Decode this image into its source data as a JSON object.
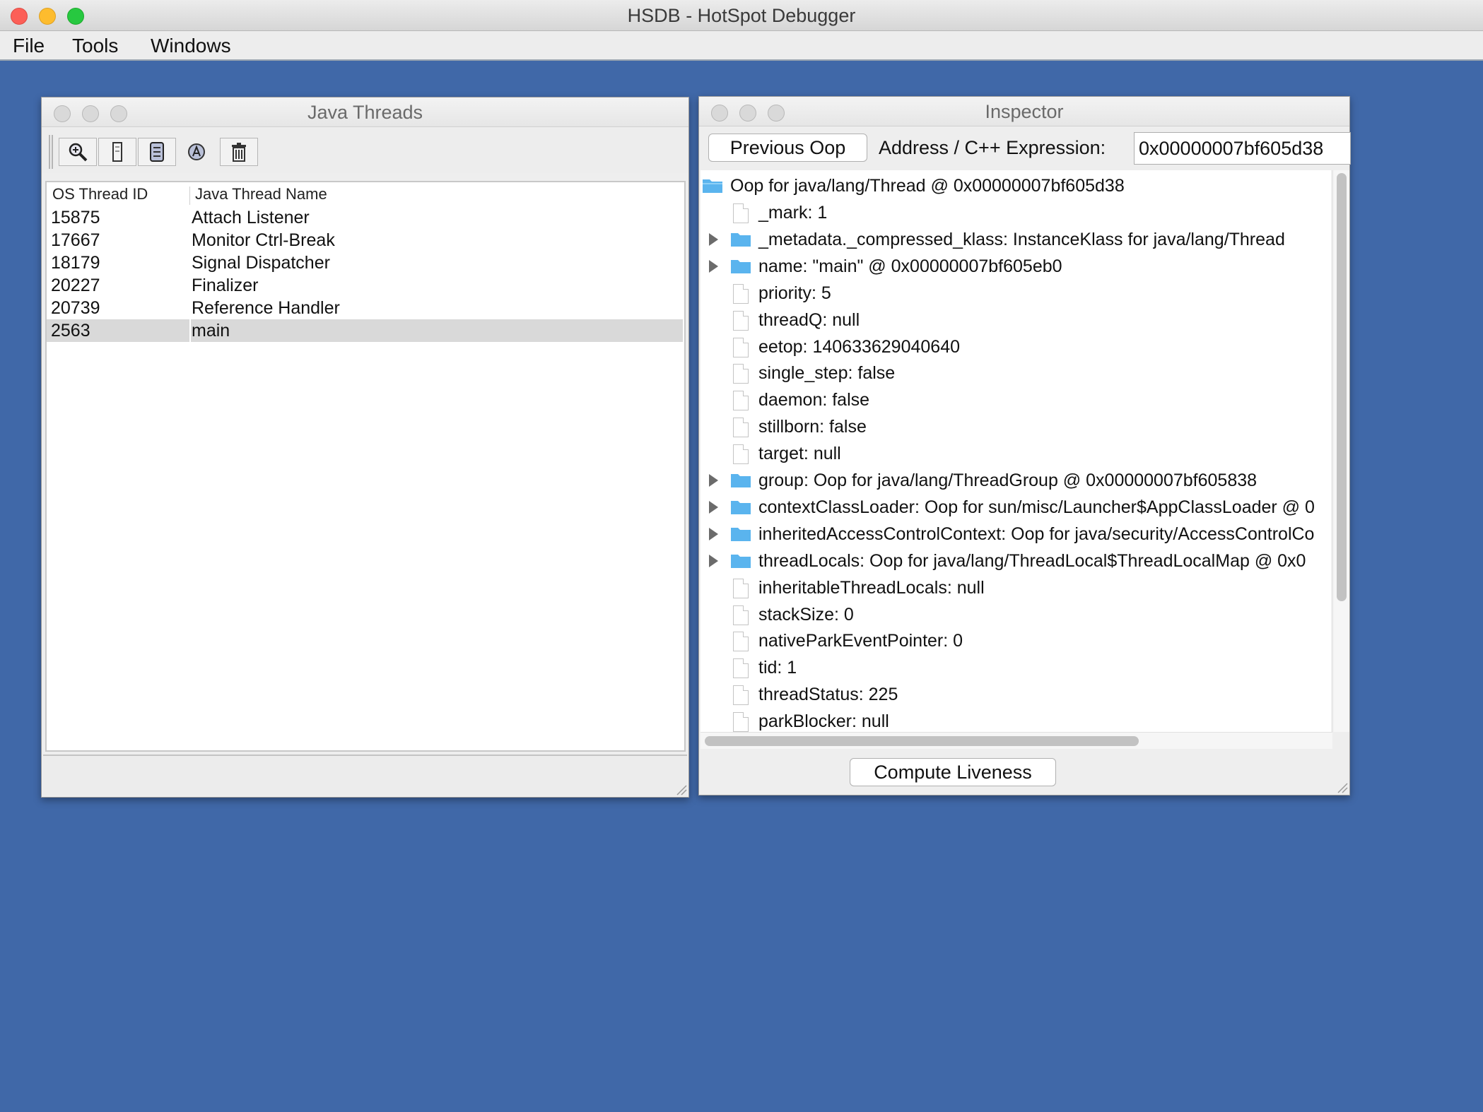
{
  "window": {
    "title": "HSDB - HotSpot Debugger"
  },
  "menu": [
    "File",
    "Tools",
    "Windows"
  ],
  "java_threads": {
    "title": "Java Threads",
    "toolbar_icons": [
      "inspect-thread-icon",
      "stack-memory-icon",
      "show-java-stack-icon",
      "thread-info-icon",
      "trash-icon"
    ],
    "columns": [
      "OS Thread ID",
      "Java Thread Name"
    ],
    "rows": [
      {
        "id": "15875",
        "name": "Attach Listener"
      },
      {
        "id": "17667",
        "name": "Monitor Ctrl-Break"
      },
      {
        "id": "18179",
        "name": "Signal Dispatcher"
      },
      {
        "id": "20227",
        "name": "Finalizer"
      },
      {
        "id": "20739",
        "name": "Reference Handler"
      },
      {
        "id": "2563",
        "name": "main"
      }
    ],
    "selected_row": 5
  },
  "inspector": {
    "title": "Inspector",
    "previous_button": "Previous Oop",
    "address_label": "Address / C++ Expression:",
    "address_value": "0x00000007bf605d38",
    "root": "Oop for java/lang/Thread @ 0x00000007bf605d38",
    "fields": [
      {
        "label": "_mark: 1",
        "expandable": false
      },
      {
        "label": "_metadata._compressed_klass: InstanceKlass for java/lang/Thread",
        "expandable": true
      },
      {
        "label": "name: \"main\" @ 0x00000007bf605eb0",
        "expandable": true
      },
      {
        "label": "priority: 5",
        "expandable": false
      },
      {
        "label": "threadQ: null",
        "expandable": false
      },
      {
        "label": "eetop: 140633629040640",
        "expandable": false
      },
      {
        "label": "single_step: false",
        "expandable": false
      },
      {
        "label": "daemon: false",
        "expandable": false
      },
      {
        "label": "stillborn: false",
        "expandable": false
      },
      {
        "label": "target: null",
        "expandable": false
      },
      {
        "label": "group: Oop for java/lang/ThreadGroup @ 0x00000007bf605838",
        "expandable": true
      },
      {
        "label": "contextClassLoader: Oop for sun/misc/Launcher$AppClassLoader @ 0",
        "expandable": true
      },
      {
        "label": "inheritedAccessControlContext: Oop for java/security/AccessControlCo",
        "expandable": true
      },
      {
        "label": "threadLocals: Oop for java/lang/ThreadLocal$ThreadLocalMap @ 0x0",
        "expandable": true
      },
      {
        "label": "inheritableThreadLocals: null",
        "expandable": false
      },
      {
        "label": "stackSize: 0",
        "expandable": false
      },
      {
        "label": "nativeParkEventPointer: 0",
        "expandable": false
      },
      {
        "label": "tid: 1",
        "expandable": false
      },
      {
        "label": "threadStatus: 225",
        "expandable": false
      },
      {
        "label": "parkBlocker: null",
        "expandable": false
      }
    ],
    "compute_button": "Compute Liveness"
  },
  "colors": {
    "desktop": "#4068a8",
    "folder": "#5ab4ee",
    "selected_row": "#d9d9d9"
  }
}
